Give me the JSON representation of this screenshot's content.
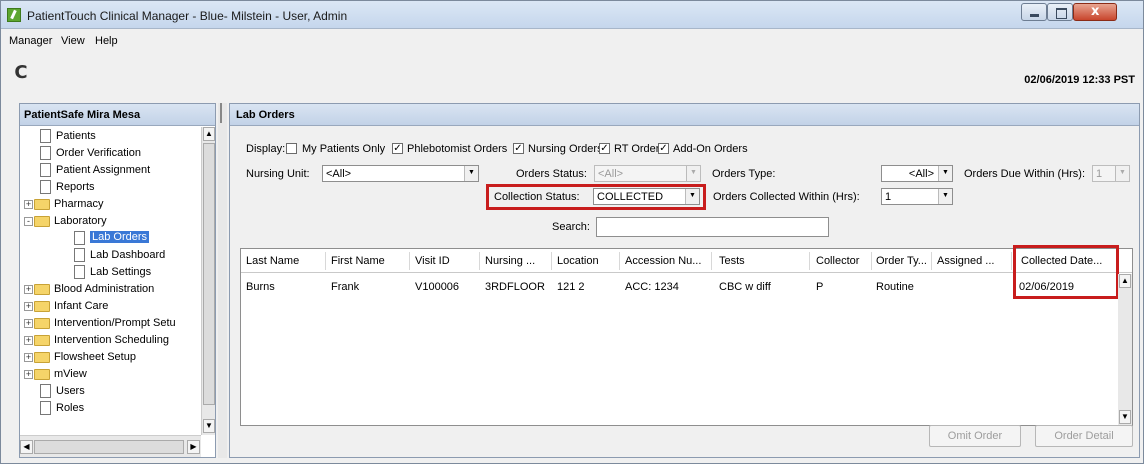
{
  "window": {
    "title": "PatientTouch Clinical Manager - Blue- Milstein - User, Admin"
  },
  "menu": [
    "Manager",
    "View",
    "Help"
  ],
  "toolbar": {
    "refresh_icon": "C",
    "datetime": "02/06/2019 12:33 PST"
  },
  "left_pane": {
    "header": "PatientSafe Mira Mesa",
    "tree": [
      {
        "label": "Patients",
        "kind": "doc",
        "level": 0
      },
      {
        "label": "Order Verification",
        "kind": "doc",
        "level": 0
      },
      {
        "label": "Patient Assignment",
        "kind": "doc",
        "level": 0
      },
      {
        "label": "Reports",
        "kind": "doc",
        "level": 0
      },
      {
        "label": "Pharmacy",
        "kind": "folder",
        "level": 0,
        "expander": "+"
      },
      {
        "label": "Laboratory",
        "kind": "folder",
        "level": 0,
        "expander": "-"
      },
      {
        "label": "Lab Orders",
        "kind": "doc",
        "level": 1,
        "selected": true
      },
      {
        "label": "Lab Dashboard",
        "kind": "doc",
        "level": 1
      },
      {
        "label": "Lab Settings",
        "kind": "doc",
        "level": 1
      },
      {
        "label": "Blood Administration",
        "kind": "folder",
        "level": 0,
        "expander": "+"
      },
      {
        "label": "Infant Care",
        "kind": "folder",
        "level": 0,
        "expander": "+"
      },
      {
        "label": "Intervention/Prompt Setu",
        "kind": "folder",
        "level": 0,
        "expander": "+"
      },
      {
        "label": "Intervention Scheduling",
        "kind": "folder",
        "level": 0,
        "expander": "+"
      },
      {
        "label": "Flowsheet Setup",
        "kind": "folder",
        "level": 0,
        "expander": "+"
      },
      {
        "label": "mView",
        "kind": "folder",
        "level": 0,
        "expander": "+"
      },
      {
        "label": "Users",
        "kind": "doc",
        "level": 0
      },
      {
        "label": "Roles",
        "kind": "doc",
        "level": 0
      }
    ]
  },
  "lab_orders": {
    "header": "Lab Orders",
    "display_label": "Display:",
    "display_options": [
      {
        "label": "My Patients Only",
        "checked": false
      },
      {
        "label": "Phlebotomist Orders",
        "checked": true
      },
      {
        "label": "Nursing Orders",
        "checked": true
      },
      {
        "label": "RT Orders",
        "checked": true
      },
      {
        "label": "Add-On Orders",
        "checked": true
      }
    ],
    "nursing_unit": {
      "label": "Nursing Unit:",
      "value": "<All>"
    },
    "orders_status": {
      "label": "Orders Status:",
      "value": "<All>",
      "disabled": true
    },
    "orders_type": {
      "label": "Orders Type:",
      "value": "<All>"
    },
    "orders_due_within": {
      "label": "Orders Due Within (Hrs):",
      "value": "1",
      "disabled": true
    },
    "collection_status": {
      "label": "Collection Status:",
      "value": "COLLECTED"
    },
    "orders_collected_within": {
      "label": "Orders Collected Within (Hrs):",
      "value": "1"
    },
    "search": {
      "label": "Search:",
      "value": ""
    },
    "columns": [
      "Last Name",
      "First Name",
      "Visit ID",
      "Nursing ...",
      "Location",
      "Accession Nu...",
      "Tests",
      "Collector",
      "Order Ty...",
      "Assigned ...",
      "Collected Date..."
    ],
    "rows": [
      [
        "Burns",
        "Frank",
        "V100006",
        "3RDFLOOR",
        "121 2",
        "ACC: 1234",
        "CBC w diff",
        "P",
        "Routine",
        "",
        "02/06/2019"
      ]
    ],
    "buttons": {
      "omit": "Omit Order",
      "detail": "Order Detail"
    }
  },
  "colors": {
    "highlight_box": "#c81d1d",
    "selection": "#3a78d6"
  }
}
